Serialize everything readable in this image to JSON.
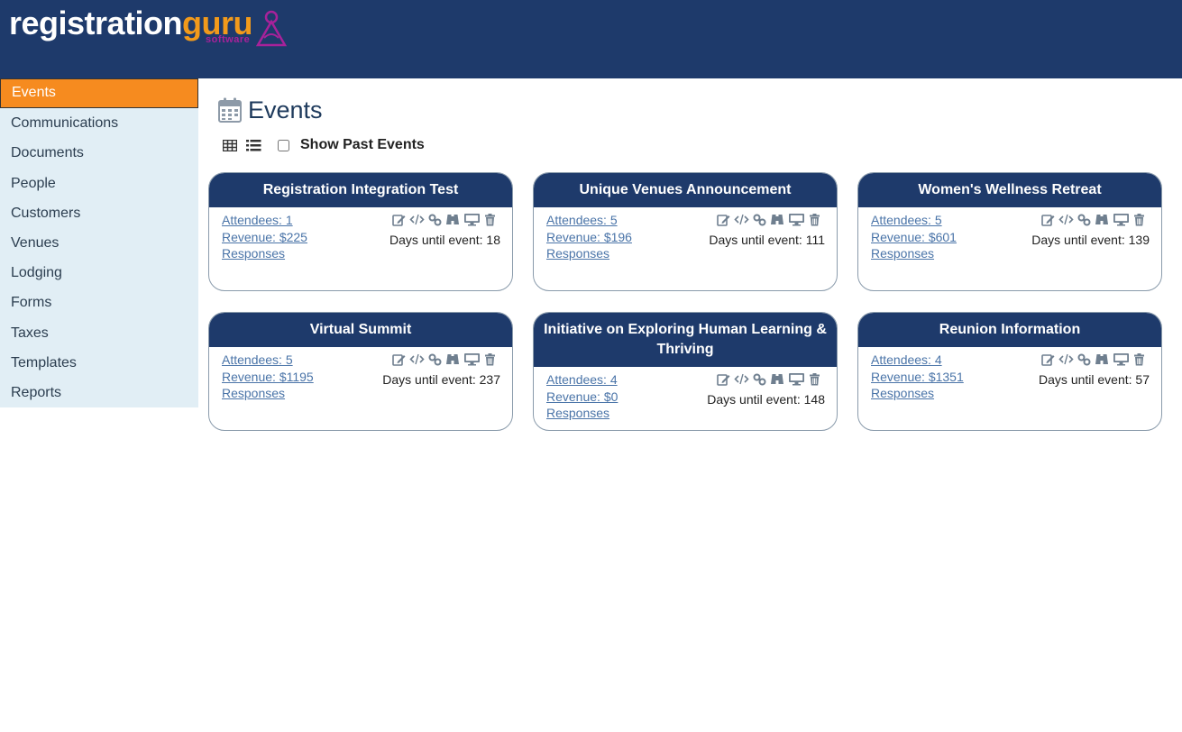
{
  "brand": {
    "name_part1": "registration",
    "name_part2": "guru",
    "sub": "software"
  },
  "sidebar": {
    "items": [
      {
        "label": "Events",
        "active": true
      },
      {
        "label": "Communications"
      },
      {
        "label": "Documents"
      },
      {
        "label": "People"
      },
      {
        "label": "Customers"
      },
      {
        "label": "Venues"
      },
      {
        "label": "Lodging"
      },
      {
        "label": "Forms"
      },
      {
        "label": "Taxes"
      },
      {
        "label": "Templates"
      },
      {
        "label": "Reports"
      }
    ]
  },
  "page": {
    "title": "Events",
    "show_past_label": "Show Past Events",
    "show_past_checked": false
  },
  "colors": {
    "header": "#1e3a6b",
    "accent": "#f68b1f",
    "sidebar": "#e1eef5",
    "link": "#4a74a8"
  },
  "events": [
    {
      "title": "Registration Integration Test",
      "attendees": "Attendees: 1",
      "revenue": "Revenue: $225",
      "responses": "Responses",
      "days": "Days until event: 18"
    },
    {
      "title": "Unique Venues Announcement",
      "attendees": "Attendees: 5",
      "revenue": "Revenue: $196",
      "responses": "Responses",
      "days": "Days until event: 111"
    },
    {
      "title": "Women's Wellness Retreat",
      "attendees": "Attendees: 5",
      "revenue": "Revenue: $601",
      "responses": "Responses",
      "days": "Days until event: 139"
    },
    {
      "title": "Virtual Summit",
      "attendees": "Attendees: 5",
      "revenue": "Revenue: $1195",
      "responses": "Responses",
      "days": "Days until event: 237"
    },
    {
      "title": "Initiative on Exploring Human Learning & Thriving",
      "attendees": "Attendees: 4",
      "revenue": "Revenue: $0",
      "responses": "Responses",
      "days": "Days until event: 148"
    },
    {
      "title": "Reunion Information",
      "attendees": "Attendees: 4",
      "revenue": "Revenue: $1351",
      "responses": "Responses",
      "days": "Days until event: 57"
    }
  ],
  "event_actions": [
    "edit-icon",
    "code-icon",
    "link-icon",
    "binoculars-icon",
    "monitor-icon",
    "trash-icon"
  ]
}
